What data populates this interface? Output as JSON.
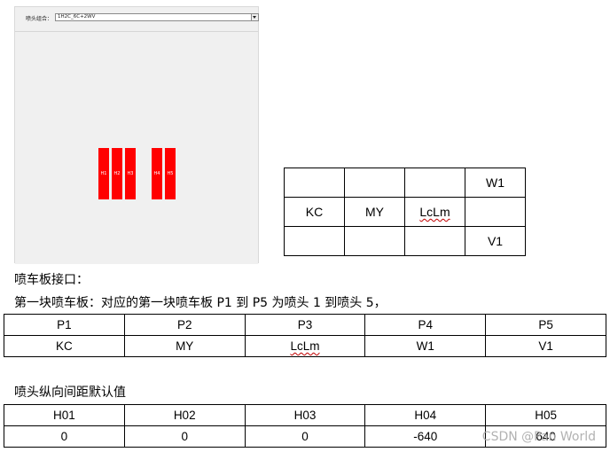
{
  "screenshot": {
    "combo_label": "喷头组合：",
    "combo_value": "1H2C_6C+2WV",
    "nozzles": [
      "H1",
      "H2",
      "H3",
      "H4",
      "H5"
    ]
  },
  "small_grid": {
    "rows": [
      [
        "",
        "",
        "",
        "W1"
      ],
      [
        "KC",
        "MY",
        "LcLm",
        ""
      ],
      [
        "",
        "",
        "",
        "V1"
      ]
    ]
  },
  "text": {
    "interface_heading": "喷车板接口：",
    "board_line": "第一块喷车板：对应的第一块喷车板 P1 到 P5 为喷头 1 到喷头 5，",
    "spacing_heading": "喷头纵向间距默认值"
  },
  "ports_table": {
    "headers": [
      "P1",
      "P2",
      "P3",
      "P4",
      "P5"
    ],
    "values": [
      "KC",
      "MY",
      "LcLm",
      "W1",
      "V1"
    ]
  },
  "spacing_table": {
    "headers": [
      "H01",
      "H02",
      "H03",
      "H04",
      "H05"
    ],
    "values": [
      "0",
      "0",
      "0",
      "-640",
      "640"
    ]
  },
  "watermark": "CSDN @Pan World"
}
